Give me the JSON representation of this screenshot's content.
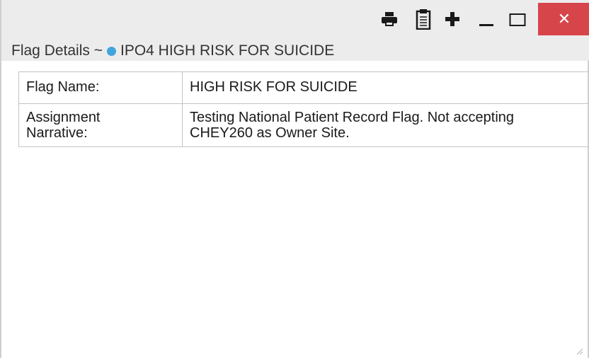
{
  "window": {
    "title_prefix": "Flag Details ~",
    "flag_name": "IPO4 HIGH RISK FOR SUICIDE",
    "flag_dot_color": "#41a4dc",
    "close_color": "#d6454a",
    "toolbar": {
      "print_icon": "print-icon",
      "clipboard_icon": "clipboard-icon",
      "add_icon": "plus-icon",
      "minimize_icon": "minimize-icon",
      "maximize_icon": "maximize-icon",
      "close_icon": "close-icon",
      "close_glyph": "✕"
    }
  },
  "details": [
    {
      "label": "Flag Name:",
      "value": "HIGH RISK FOR SUICIDE"
    },
    {
      "label_line1": "Assignment",
      "label_line2": "Narrative:",
      "value_line1": "Testing National Patient Record Flag. Not accepting",
      "value_line2": "CHEY260 as Owner Site."
    }
  ]
}
